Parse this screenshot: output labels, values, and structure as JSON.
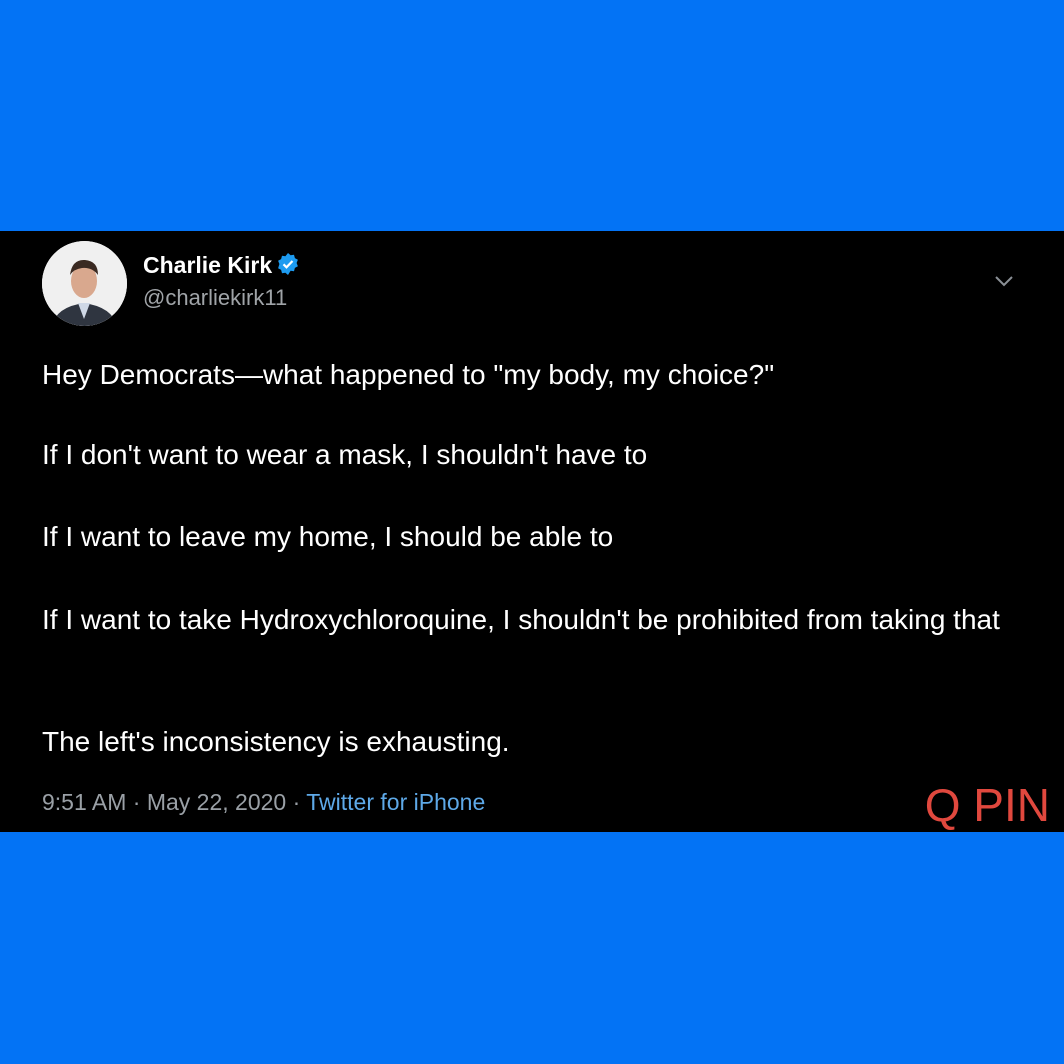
{
  "tweet": {
    "author_name": "Charlie Kirk",
    "handle": "@charliekirk11",
    "verified": true,
    "paragraphs": [
      "Hey Democrats—what happened to \"my body, my choice?\"",
      "If I don't want to wear a mask, I shouldn't have to",
      "If I want to leave my home, I should be able to",
      "If I want to take Hydroxychloroquine, I shouldn't be prohibited from taking that",
      "The left's inconsistency is exhausting."
    ],
    "time": "9:51 AM",
    "date": "May 22, 2020",
    "separator": "·",
    "source": "Twitter for iPhone"
  },
  "watermark": "Q PIN",
  "colors": {
    "background": "#0373f5",
    "card": "#000000",
    "link": "#5ea9e8",
    "watermark": "#e0483e",
    "verified": "#1d9bf0"
  },
  "icons": {
    "verified": "verified-badge-icon",
    "menu": "chevron-down-icon"
  }
}
